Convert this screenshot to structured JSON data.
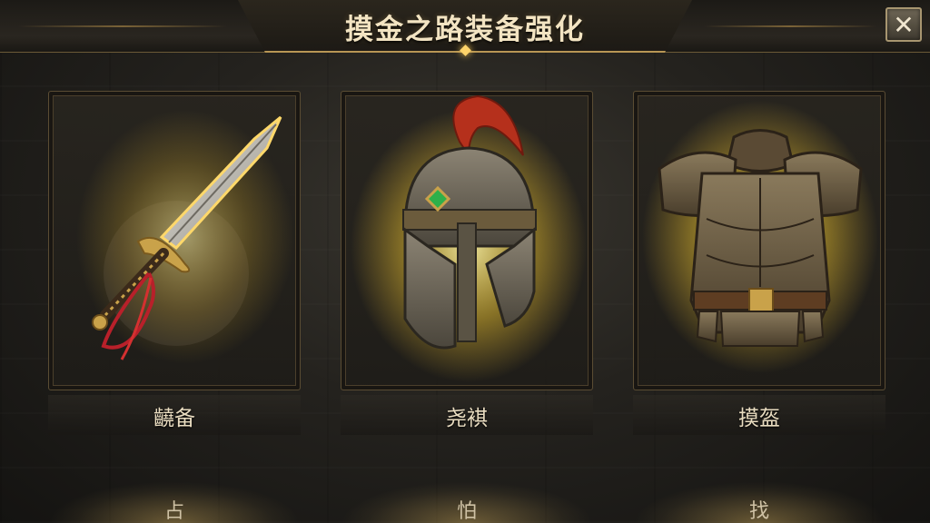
{
  "header": {
    "title": "摸金之路装备强化",
    "close_label": "✕"
  },
  "cards": [
    {
      "label": "䶧备",
      "icon": "sword-icon"
    },
    {
      "label": "尧褀",
      "icon": "helmet-icon"
    },
    {
      "label": "摸盔",
      "icon": "armor-icon"
    }
  ],
  "bottom": [
    {
      "label": "占"
    },
    {
      "label": "怕"
    },
    {
      "label": "找"
    }
  ],
  "colors": {
    "accent_gold": "#ffd46a",
    "frame": "#5a4c33",
    "text": "#e9dcc0"
  }
}
